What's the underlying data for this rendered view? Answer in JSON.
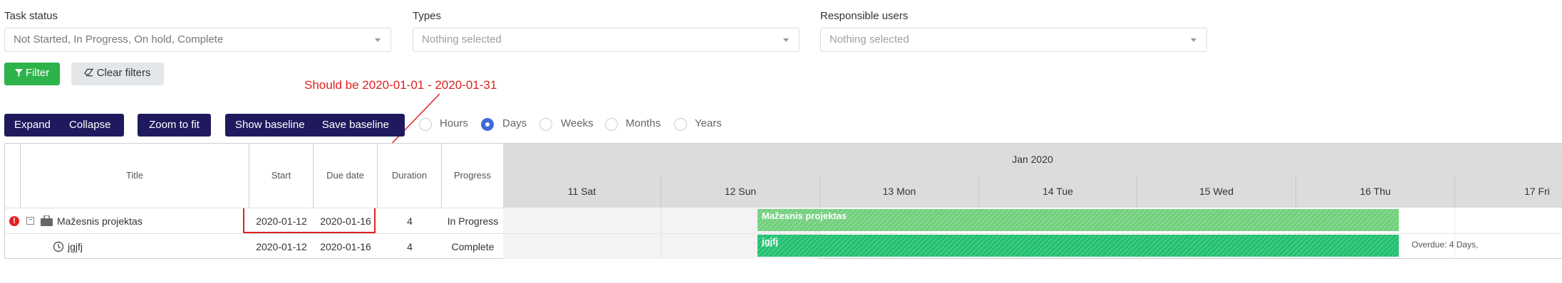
{
  "filters": {
    "status": {
      "label": "Task status",
      "value": "Not Started, In Progress, On hold, Complete"
    },
    "types": {
      "label": "Types",
      "placeholder": "Nothing selected"
    },
    "users": {
      "label": "Responsible users",
      "placeholder": "Nothing selected"
    },
    "filter_button": "Filter",
    "clear_button": "Clear filters"
  },
  "annotation": {
    "text": "Should be 2020-01-01 - 2020-01-31",
    "color": "#e02020"
  },
  "toolbar": {
    "expand": "Expand",
    "collapse": "Collapse",
    "zoom_to_fit": "Zoom to fit",
    "show_baseline": "Show baseline",
    "save_baseline": "Save baseline",
    "scales": [
      "Hours",
      "Days",
      "Weeks",
      "Months",
      "Years"
    ],
    "selected_scale": "Days"
  },
  "grid": {
    "columns": [
      "Title",
      "Start",
      "Due date",
      "Duration",
      "Progress"
    ],
    "rows": [
      {
        "title": "Mažesnis projektas",
        "start": "2020-01-12",
        "due": "2020-01-16",
        "duration": "4",
        "progress": "In Progress",
        "type": "project"
      },
      {
        "title": "jgjfj",
        "start": "2020-01-12",
        "due": "2020-01-16",
        "duration": "4",
        "progress": "Complete",
        "type": "task"
      }
    ]
  },
  "timeline": {
    "month": "Jan 2020",
    "days": [
      "11 Sat",
      "12 Sun",
      "13 Mon",
      "14 Tue",
      "15 Wed",
      "16 Thu",
      "17 Fri"
    ],
    "bars": [
      {
        "label": "Mažesnis projektas",
        "color": "#6fcf7a"
      },
      {
        "label": "jgjfj",
        "color": "#1fbf6f"
      }
    ],
    "overdue_text": "Overdue: 4 Days,"
  },
  "colors": {
    "accent_navy": "#1f1a5e",
    "filter_green": "#2db34a",
    "alert_red": "#e02020"
  }
}
